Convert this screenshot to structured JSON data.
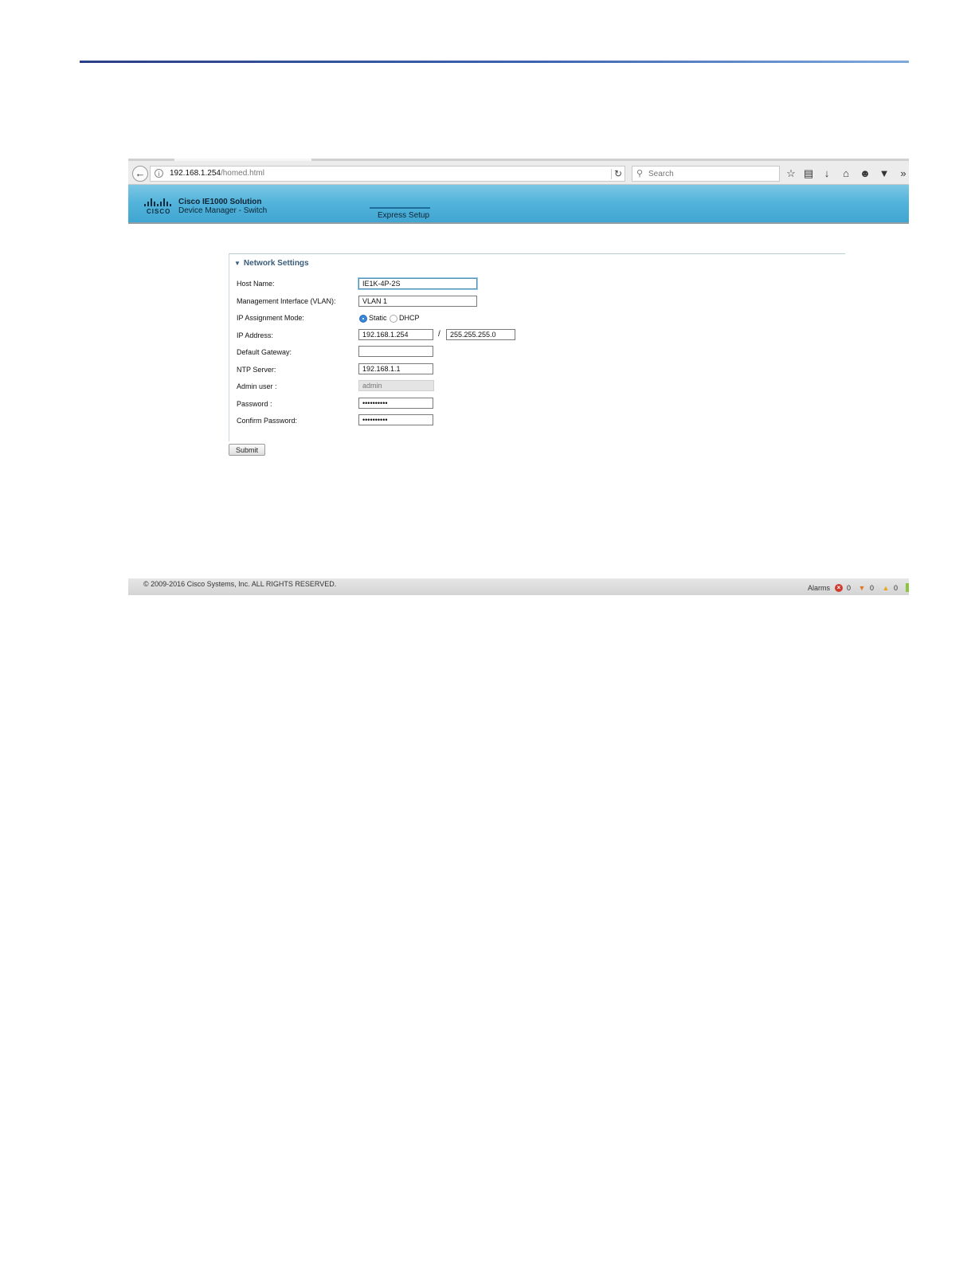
{
  "browser": {
    "url_host": "192.168.1.254",
    "url_path": "/homed.html",
    "search_placeholder": "Search"
  },
  "header": {
    "logo_text": "CISCO",
    "title": "Cisco IE1000 Solution",
    "subtitle": "Device Manager - Switch",
    "active_tab": "Express Setup"
  },
  "form": {
    "section_title": "Network Settings",
    "host_name": {
      "label": "Host Name:",
      "value": "IE1K-4P-2S"
    },
    "mgmt_interface": {
      "label": "Management Interface (VLAN):",
      "value": "VLAN 1"
    },
    "ip_mode": {
      "label": "IP Assignment Mode:",
      "option_static": "Static",
      "option_dhcp": "DHCP",
      "selected": "Static"
    },
    "ip_address": {
      "label": "IP Address:",
      "value": "192.168.1.254",
      "separator": "/",
      "mask": "255.255.255.0"
    },
    "default_gateway": {
      "label": "Default Gateway:",
      "value": ""
    },
    "ntp_server": {
      "label": "NTP Server:",
      "value": "192.168.1.1"
    },
    "admin_user": {
      "label": "Admin user :",
      "value": "admin"
    },
    "password": {
      "label": "Password :",
      "value": "••••••••••"
    },
    "confirm_password": {
      "label": "Confirm Password:",
      "value": "••••••••••"
    },
    "submit_label": "Submit"
  },
  "footer": {
    "copyright": "© 2009-2016 Cisco Systems, Inc. ALL RIGHTS RESERVED.",
    "alarms_label": "Alarms",
    "critical_count": "0",
    "major_count": "0",
    "minor_count": "0"
  }
}
